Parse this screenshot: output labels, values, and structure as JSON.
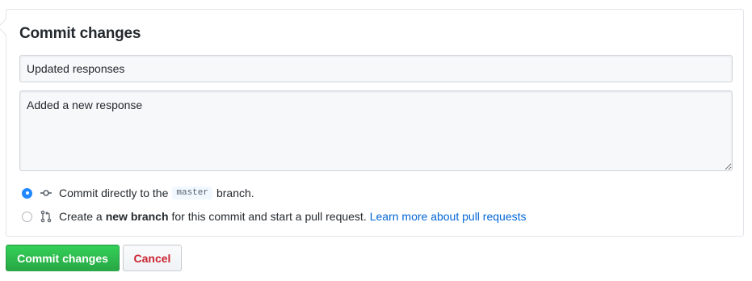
{
  "form": {
    "title": "Commit changes",
    "summary_value": "Updated responses",
    "description_value": "Added a new response"
  },
  "options": {
    "direct": {
      "selected": true,
      "icon": "git-commit-icon",
      "text_before": "Commit directly to the",
      "branch_name": "master",
      "text_after": "branch."
    },
    "new_branch": {
      "selected": false,
      "icon": "git-pull-request-icon",
      "text_before": "Create a",
      "bold_text": "new branch",
      "text_after": "for this commit and start a pull request.",
      "link_text": "Learn more about pull requests"
    }
  },
  "buttons": {
    "commit_label": "Commit changes",
    "cancel_label": "Cancel"
  },
  "colors": {
    "commit_button": "#28a745",
    "cancel_text": "#cb2431",
    "link": "#0366d6",
    "radio_selected": "#2188ff"
  }
}
